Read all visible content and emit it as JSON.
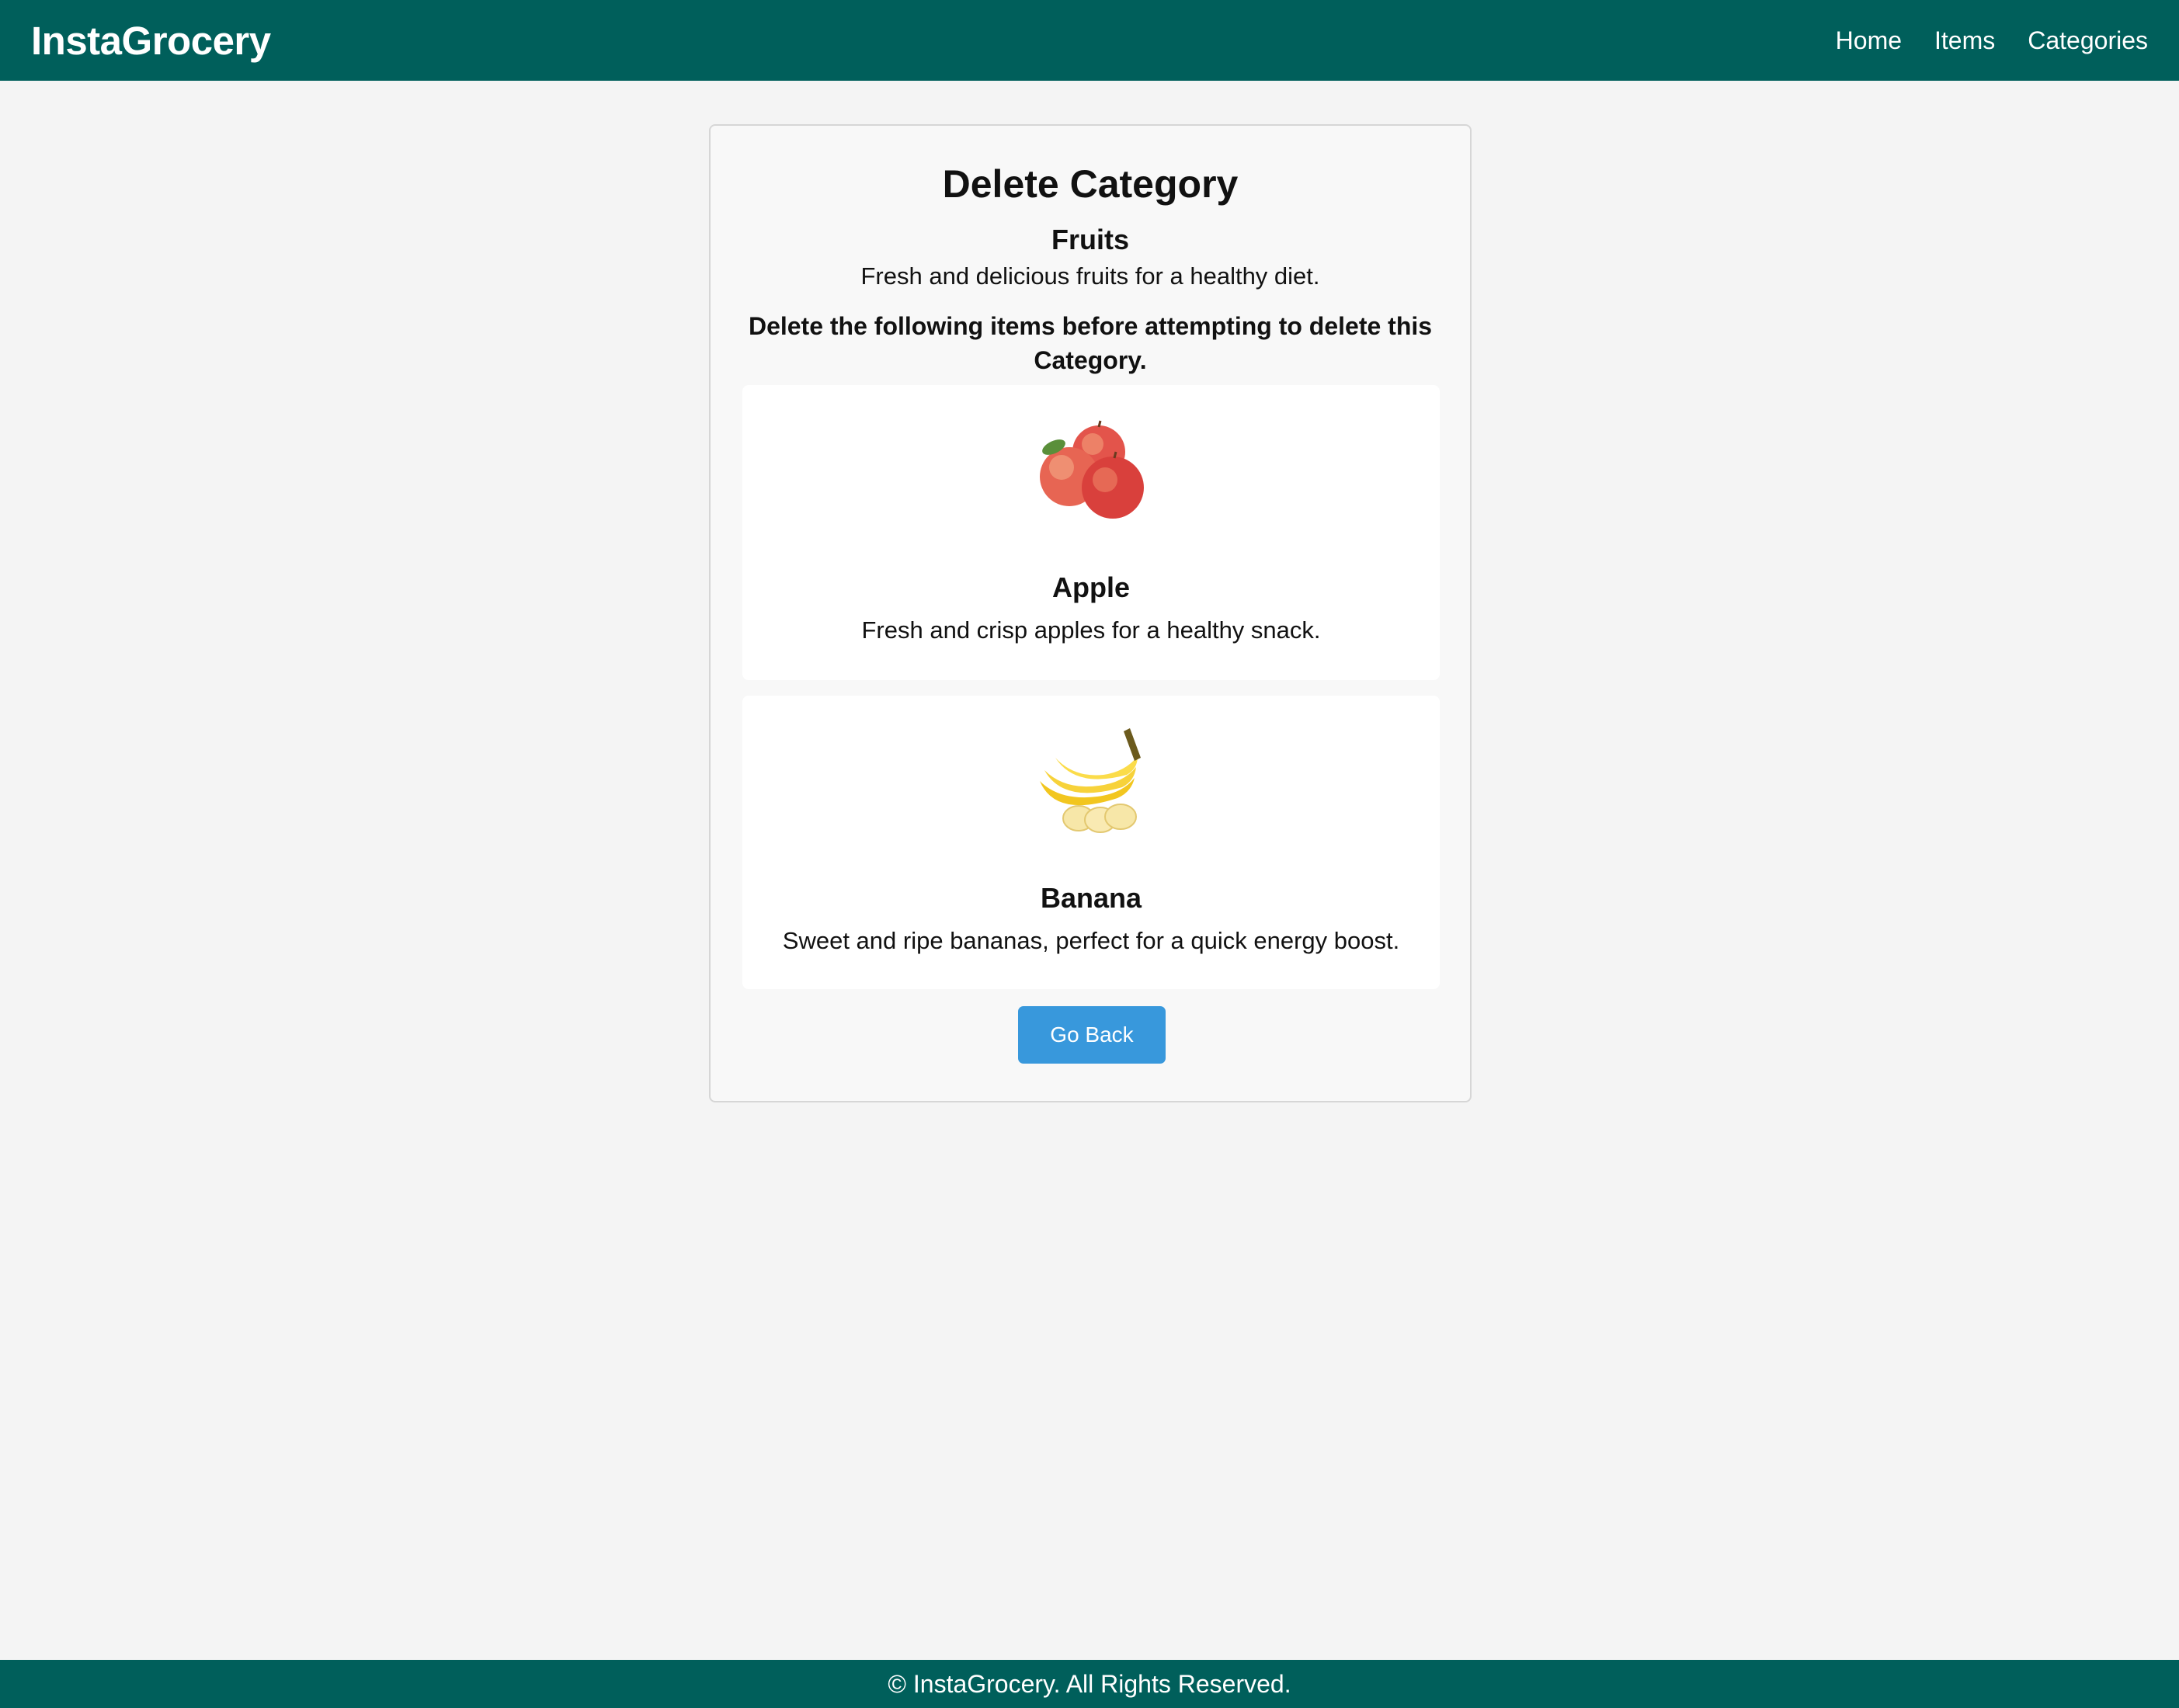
{
  "header": {
    "brand": "InstaGrocery",
    "nav": [
      "Home",
      "Items",
      "Categories"
    ]
  },
  "page": {
    "title": "Delete Category",
    "category_name": "Fruits",
    "category_description": "Fresh and delicious fruits for a healthy diet.",
    "warning": "Delete the following items before attempting to delete this Category."
  },
  "items": [
    {
      "name": "Apple",
      "description": "Fresh and crisp apples for a healthy snack.",
      "image_icon": "apples-image"
    },
    {
      "name": "Banana",
      "description": "Sweet and ripe bananas, perfect for a quick energy boost.",
      "image_icon": "bananas-image"
    }
  ],
  "actions": {
    "back_label": "Go Back"
  },
  "footer": {
    "text": "© InstaGrocery. All Rights Reserved."
  },
  "colors": {
    "header_bg": "#005f5b",
    "button_bg": "#3898dc",
    "page_bg": "#f4f4f4"
  }
}
